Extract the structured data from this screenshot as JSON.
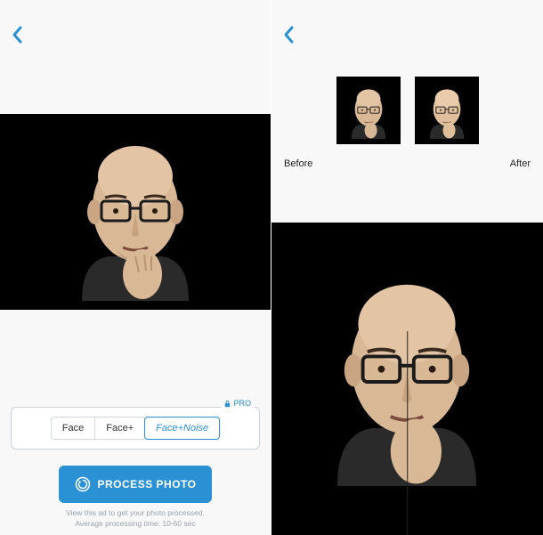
{
  "left": {
    "options": {
      "face": "Face",
      "face_plus": "Face+",
      "face_noise": "Face+Noise"
    },
    "pro": "PRO",
    "process_label": "PROCESS PHOTO",
    "tip1": "View this ad to get your photo processed.",
    "tip2": "Average processing time: 10-60 sec"
  },
  "right": {
    "before": "Before",
    "after": "After"
  }
}
